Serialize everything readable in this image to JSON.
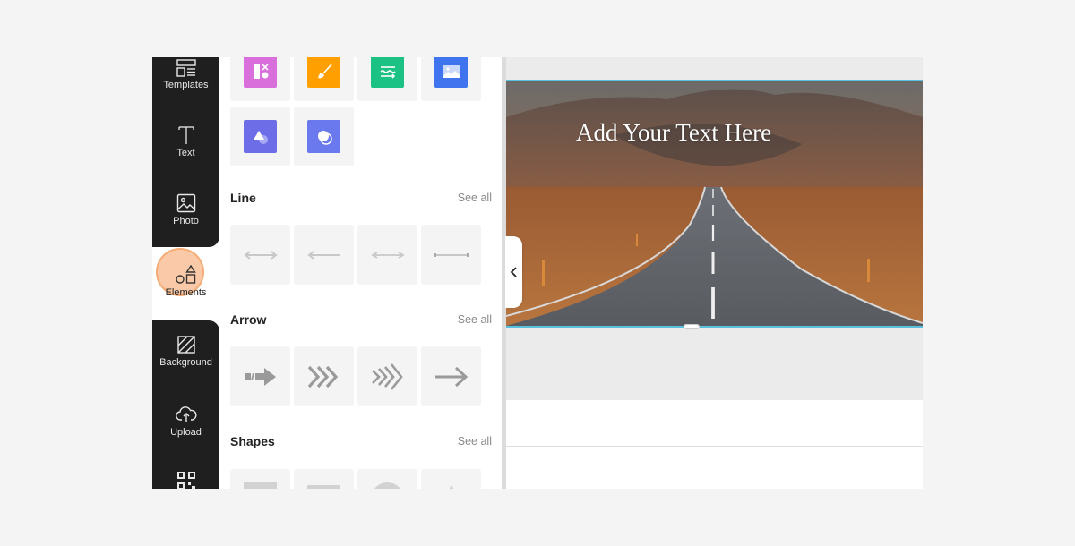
{
  "sidebar": {
    "items": [
      {
        "label": "Templates",
        "icon": "templates-icon"
      },
      {
        "label": "Text",
        "icon": "text-icon"
      },
      {
        "label": "Photo",
        "icon": "photo-icon"
      },
      {
        "label": "Elements",
        "icon": "elements-icon",
        "active": true
      },
      {
        "label": "Background",
        "icon": "background-icon"
      },
      {
        "label": "Upload",
        "icon": "upload-icon"
      },
      {
        "label": "",
        "icon": "qr-code-icon"
      }
    ]
  },
  "panel": {
    "apps": [
      {
        "icon": "layout-app-icon",
        "color": "#d86fdb"
      },
      {
        "icon": "brush-app-icon",
        "color": "#ffa000"
      },
      {
        "icon": "text-wave-app-icon",
        "color": "#1bc283"
      },
      {
        "icon": "image-app-icon",
        "color": "#3f74ee"
      },
      {
        "icon": "shape-blend-app-icon",
        "color": "#6d6de8"
      },
      {
        "icon": "overlap-circles-app-icon",
        "color": "#6a7aee"
      }
    ],
    "sections": [
      {
        "title": "Line",
        "see_all": "See all",
        "items": [
          "double-arrow-line-icon",
          "left-arrow-line-icon",
          "double-arrow-line-thin-icon",
          "dotted-end-line-icon"
        ]
      },
      {
        "title": "Arrow",
        "see_all": "See all",
        "items": [
          "dash-arrow-icon",
          "triple-chevron-icon",
          "multi-chevron-icon",
          "simple-arrow-icon"
        ]
      },
      {
        "title": "Shapes",
        "see_all": "See all",
        "items": [
          "square-shape-icon",
          "rectangle-shape-icon",
          "circle-shape-icon",
          "triangle-shape-icon"
        ]
      }
    ]
  },
  "canvas": {
    "title_text": "Add Your Text Here",
    "selection_color": "#5bc0de"
  }
}
